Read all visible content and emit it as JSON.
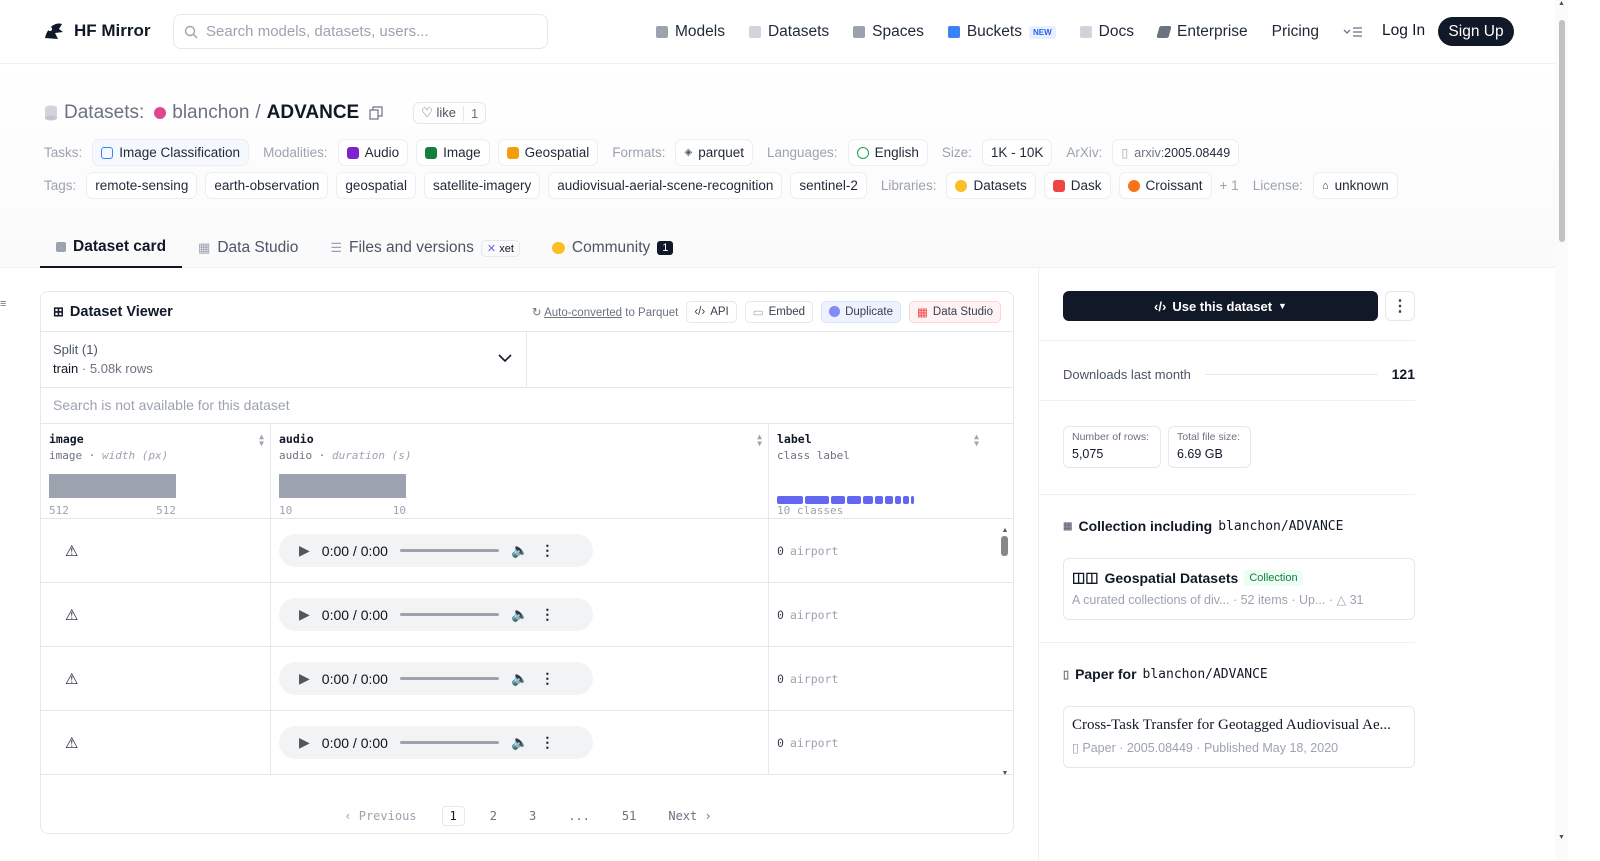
{
  "header": {
    "brand": "HF Mirror",
    "search_placeholder": "Search models, datasets, users...",
    "nav": [
      "Models",
      "Datasets",
      "Spaces",
      "Buckets",
      "Docs",
      "Enterprise",
      "Pricing"
    ],
    "new_badge": "NEW",
    "login": "Log In",
    "signup": "Sign Up"
  },
  "dataset": {
    "prefix": "Datasets:",
    "owner": "blanchon",
    "sep": "/",
    "name": "ADVANCE",
    "like_label": "like",
    "like_count": "1"
  },
  "meta": {
    "tasks_label": "Tasks:",
    "task": "Image Classification",
    "modalities_label": "Modalities:",
    "modalities": [
      "Audio",
      "Image",
      "Geospatial"
    ],
    "formats_label": "Formats:",
    "format": "parquet",
    "languages_label": "Languages:",
    "language": "English",
    "size_label": "Size:",
    "size": "1K - 10K",
    "arxiv_label": "ArXiv:",
    "arxiv_prefix": "arxiv:",
    "arxiv_id": "2005.08449",
    "tags_label": "Tags:",
    "tags": [
      "remote-sensing",
      "earth-observation",
      "geospatial",
      "satellite-imagery",
      "audiovisual-aerial-scene-recognition",
      "sentinel-2"
    ],
    "libraries_label": "Libraries:",
    "libraries": [
      "Datasets",
      "Dask",
      "Croissant"
    ],
    "libraries_more": "+ 1",
    "license_label": "License:",
    "license": "unknown"
  },
  "tabs": {
    "card": "Dataset card",
    "studio": "Data Studio",
    "files": "Files and versions",
    "xet": "xet",
    "community": "Community",
    "community_count": "1"
  },
  "viewer": {
    "title": "Dataset Viewer",
    "auto_converted": "Auto-converted",
    "to_parquet": "to Parquet",
    "api": "API",
    "embed": "Embed",
    "duplicate": "Duplicate",
    "data_studio": "Data Studio",
    "split_label": "Split (1)",
    "split_name": "train",
    "split_rows": "5.08k rows",
    "search_note": "Search is not available for this dataset",
    "columns": [
      {
        "name": "image",
        "type": "image",
        "detail": "width (px)",
        "min": "512",
        "max": "512"
      },
      {
        "name": "audio",
        "type": "audio",
        "detail": "duration (s)",
        "min": "10",
        "max": "10"
      },
      {
        "name": "label",
        "type": "class label",
        "classes": "10 classes"
      }
    ],
    "rows": [
      {
        "time": "0:00 / 0:00",
        "label_id": "0",
        "label_name": "airport"
      },
      {
        "time": "0:00 / 0:00",
        "label_id": "0",
        "label_name": "airport"
      },
      {
        "time": "0:00 / 0:00",
        "label_id": "0",
        "label_name": "airport"
      },
      {
        "time": "0:00 / 0:00",
        "label_id": "0",
        "label_name": "airport"
      }
    ],
    "pager": {
      "prev": "Previous",
      "pages": [
        "1",
        "2",
        "3",
        "...",
        "51"
      ],
      "next": "Next"
    }
  },
  "sidebar": {
    "use_dataset": "Use this dataset",
    "downloads_label": "Downloads last month",
    "downloads": "121",
    "rows_label": "Number of rows:",
    "rows_value": "5,075",
    "size_label": "Total file size:",
    "size_value": "6.69 GB",
    "collection_title": "Collection including",
    "collection_repo": "blanchon/ADVANCE",
    "collection_name": "Geospatial Datasets",
    "collection_badge": "Collection",
    "collection_desc": "A curated collections of div...",
    "collection_items": "52 items",
    "collection_updated": "Up...",
    "collection_upvotes": "31",
    "paper_title": "Paper for",
    "paper_repo": "blanchon/ADVANCE",
    "paper_name": "Cross-Task Transfer for Geotagged Audiovisual Ae...",
    "paper_label": "Paper",
    "paper_id": "2005.08449",
    "paper_published": "Published May 18, 2020"
  }
}
